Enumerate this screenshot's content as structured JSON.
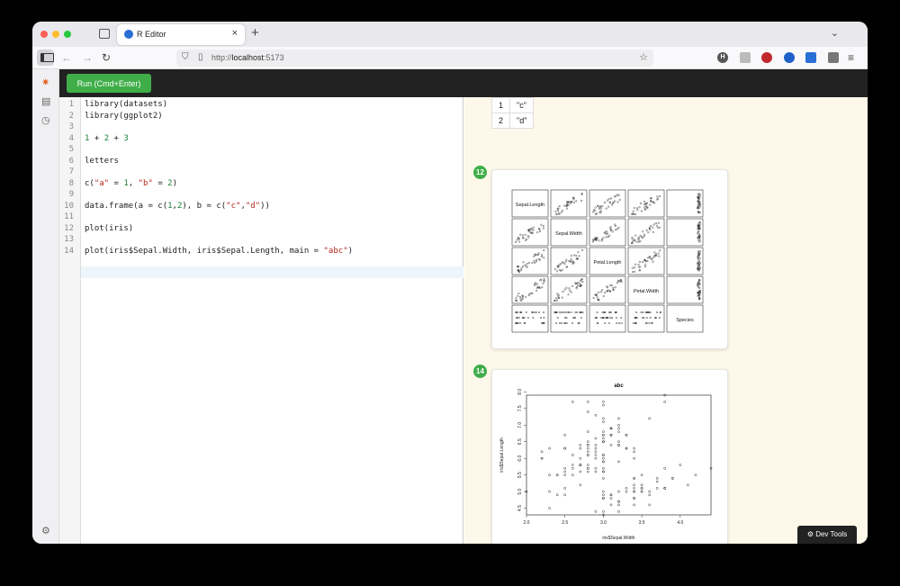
{
  "browser": {
    "tab_title": "R Editor",
    "tab_close": "×",
    "new_tab": "+",
    "url_scheme": "http://",
    "url_host": "localhost",
    "url_port": ":5173"
  },
  "toolbar": {
    "run_label": "Run (Cmd+Enter)"
  },
  "editor": {
    "lines": [
      "library(datasets)",
      "library(ggplot2)",
      "",
      "1 + 2 + 3",
      "",
      "letters",
      "",
      "c(\"a\" = 1, \"b\" = 2)",
      "",
      "data.frame(a = c(1,2), b = c(\"c\",\"d\"))",
      "",
      "plot(iris)",
      "",
      "plot(iris$Sepal.Width, iris$Sepal.Length, main = \"abc\")"
    ],
    "active_line": 14
  },
  "output": {
    "table_rows": [
      [
        "1",
        "\"c\""
      ],
      [
        "2",
        "\"d\""
      ]
    ],
    "cell_12_label": "12",
    "cell_14_label": "14",
    "pairs_labels": [
      "Sepal.Length",
      "Sepal.Width",
      "Petal.Length",
      "Petal.Width",
      "Species"
    ],
    "scatter_title": "abc",
    "scatter_xlabel": "iris$Sepal.Width",
    "scatter_ylabel": "iris$Sepal.Length",
    "scatter_xticks": [
      "2.0",
      "2.5",
      "3.0",
      "3.5",
      "4.0"
    ],
    "scatter_yticks": [
      "4.5",
      "5.0",
      "5.5",
      "6.0",
      "6.5",
      "7.0",
      "7.5",
      "8.0"
    ]
  },
  "chart_data": {
    "type": "scatter",
    "title": "abc",
    "xlabel": "iris$Sepal.Width",
    "ylabel": "iris$Sepal.Length",
    "xlim": [
      2.0,
      4.4
    ],
    "ylim": [
      4.3,
      7.9
    ],
    "x": [
      3.5,
      3.0,
      3.2,
      3.1,
      3.6,
      3.9,
      3.4,
      3.4,
      2.9,
      3.1,
      3.7,
      3.4,
      3.0,
      3.0,
      4.0,
      4.4,
      3.9,
      3.5,
      3.8,
      3.8,
      3.4,
      3.7,
      3.6,
      3.3,
      3.4,
      3.0,
      3.4,
      3.5,
      3.4,
      3.2,
      3.1,
      3.4,
      4.1,
      4.2,
      3.1,
      3.2,
      3.5,
      3.6,
      3.0,
      3.4,
      3.5,
      2.3,
      3.2,
      3.5,
      3.8,
      3.0,
      3.8,
      3.2,
      3.7,
      3.3,
      3.2,
      3.2,
      3.1,
      2.3,
      2.8,
      2.8,
      3.3,
      2.4,
      2.9,
      2.7,
      2.0,
      3.0,
      2.2,
      2.9,
      2.9,
      3.1,
      3.0,
      2.7,
      2.2,
      2.5,
      3.2,
      2.8,
      2.5,
      2.8,
      2.9,
      3.0,
      2.8,
      3.0,
      2.9,
      2.6,
      2.4,
      2.4,
      2.7,
      2.7,
      3.0,
      3.4,
      3.1,
      2.3,
      3.0,
      2.5,
      2.6,
      3.0,
      2.6,
      2.3,
      2.7,
      3.0,
      2.9,
      2.9,
      2.5,
      2.8,
      3.3,
      2.7,
      3.0,
      2.9,
      3.0,
      3.0,
      2.5,
      2.9,
      2.5,
      3.6,
      3.2,
      2.7,
      3.0,
      2.5,
      2.8,
      3.2,
      3.0,
      3.8,
      2.6,
      2.2,
      3.2,
      2.8,
      2.8,
      2.7,
      3.3,
      3.2,
      2.8,
      3.0,
      2.8,
      3.0,
      2.8,
      3.8,
      2.8,
      2.8,
      2.6,
      3.0,
      3.4,
      3.1,
      3.0,
      3.1,
      3.1,
      3.1,
      2.7,
      3.2,
      3.3,
      3.0,
      2.5,
      3.0,
      3.4,
      3.0
    ],
    "y": [
      5.1,
      4.9,
      4.7,
      4.6,
      5.0,
      5.4,
      4.6,
      5.0,
      4.4,
      4.9,
      5.4,
      4.8,
      4.8,
      4.3,
      5.8,
      5.7,
      5.4,
      5.1,
      5.7,
      5.1,
      5.4,
      5.1,
      4.6,
      5.1,
      4.8,
      5.0,
      5.0,
      5.2,
      5.2,
      4.7,
      4.8,
      5.4,
      5.2,
      5.5,
      4.9,
      5.0,
      5.5,
      4.9,
      4.4,
      5.1,
      5.0,
      4.5,
      4.4,
      5.0,
      5.1,
      4.8,
      5.1,
      4.6,
      5.3,
      5.0,
      7.0,
      6.4,
      6.9,
      5.5,
      6.5,
      5.7,
      6.3,
      4.9,
      6.6,
      5.2,
      5.0,
      5.9,
      6.0,
      6.1,
      5.6,
      6.7,
      5.6,
      5.8,
      6.2,
      5.6,
      5.9,
      6.1,
      6.3,
      6.1,
      6.4,
      6.6,
      6.8,
      6.7,
      6.0,
      5.7,
      5.5,
      5.5,
      5.8,
      6.0,
      5.4,
      6.0,
      6.7,
      6.3,
      5.6,
      5.5,
      5.5,
      6.1,
      5.8,
      5.0,
      5.6,
      5.7,
      5.7,
      6.2,
      5.1,
      5.7,
      6.3,
      5.8,
      7.1,
      6.3,
      6.5,
      7.6,
      4.9,
      7.3,
      6.7,
      7.2,
      6.5,
      6.4,
      6.8,
      5.7,
      5.8,
      6.4,
      6.5,
      7.7,
      7.7,
      6.0,
      6.9,
      5.6,
      7.7,
      6.3,
      6.7,
      7.2,
      6.2,
      6.1,
      6.4,
      7.2,
      7.4,
      7.9,
      6.4,
      6.3,
      6.1,
      7.7,
      6.3,
      6.4,
      6.0,
      6.9,
      6.7,
      6.9,
      5.8,
      6.8,
      6.7,
      6.7,
      6.3,
      6.5,
      6.2,
      5.9
    ]
  }
}
